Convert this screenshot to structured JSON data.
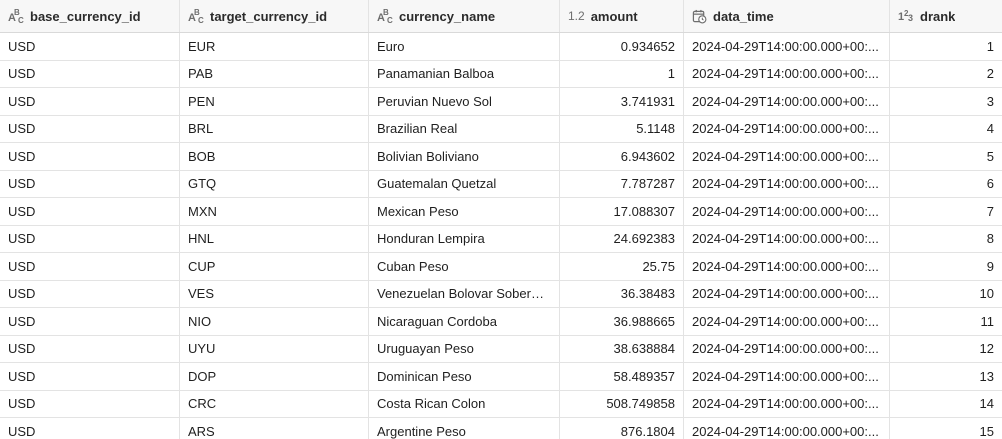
{
  "columns": [
    {
      "label": "base_currency_id",
      "icon": "text-type-icon",
      "align": "left"
    },
    {
      "label": "target_currency_id",
      "icon": "text-type-icon",
      "align": "left"
    },
    {
      "label": "currency_name",
      "icon": "text-type-icon",
      "align": "left"
    },
    {
      "label": "amount",
      "icon": "decimal-type-icon",
      "icon_text": "1.2",
      "align": "right"
    },
    {
      "label": "data_time",
      "icon": "calendar-clock-icon",
      "align": "left"
    },
    {
      "label": "drank",
      "icon": "integer-type-icon",
      "align": "right"
    }
  ],
  "rows": [
    [
      "USD",
      "EUR",
      "Euro",
      "0.934652",
      "2024-04-29T14:00:00.000+00:...",
      "1"
    ],
    [
      "USD",
      "PAB",
      "Panamanian Balboa",
      "1",
      "2024-04-29T14:00:00.000+00:...",
      "2"
    ],
    [
      "USD",
      "PEN",
      "Peruvian Nuevo Sol",
      "3.741931",
      "2024-04-29T14:00:00.000+00:...",
      "3"
    ],
    [
      "USD",
      "BRL",
      "Brazilian Real",
      "5.1148",
      "2024-04-29T14:00:00.000+00:...",
      "4"
    ],
    [
      "USD",
      "BOB",
      "Bolivian Boliviano",
      "6.943602",
      "2024-04-29T14:00:00.000+00:...",
      "5"
    ],
    [
      "USD",
      "GTQ",
      "Guatemalan Quetzal",
      "7.787287",
      "2024-04-29T14:00:00.000+00:...",
      "6"
    ],
    [
      "USD",
      "MXN",
      "Mexican Peso",
      "17.088307",
      "2024-04-29T14:00:00.000+00:...",
      "7"
    ],
    [
      "USD",
      "HNL",
      "Honduran Lempira",
      "24.692383",
      "2024-04-29T14:00:00.000+00:...",
      "8"
    ],
    [
      "USD",
      "CUP",
      "Cuban Peso",
      "25.75",
      "2024-04-29T14:00:00.000+00:...",
      "9"
    ],
    [
      "USD",
      "VES",
      "Venezuelan Bolovar Soberano",
      "36.38483",
      "2024-04-29T14:00:00.000+00:...",
      "10"
    ],
    [
      "USD",
      "NIO",
      "Nicaraguan Cordoba",
      "36.988665",
      "2024-04-29T14:00:00.000+00:...",
      "11"
    ],
    [
      "USD",
      "UYU",
      "Uruguayan Peso",
      "38.638884",
      "2024-04-29T14:00:00.000+00:...",
      "12"
    ],
    [
      "USD",
      "DOP",
      "Dominican Peso",
      "58.489357",
      "2024-04-29T14:00:00.000+00:...",
      "13"
    ],
    [
      "USD",
      "CRC",
      "Costa Rican Colon",
      "508.749858",
      "2024-04-29T14:00:00.000+00:...",
      "14"
    ],
    [
      "USD",
      "ARS",
      "Argentine Peso",
      "876.1804",
      "2024-04-29T14:00:00.000+00:...",
      "15"
    ]
  ]
}
